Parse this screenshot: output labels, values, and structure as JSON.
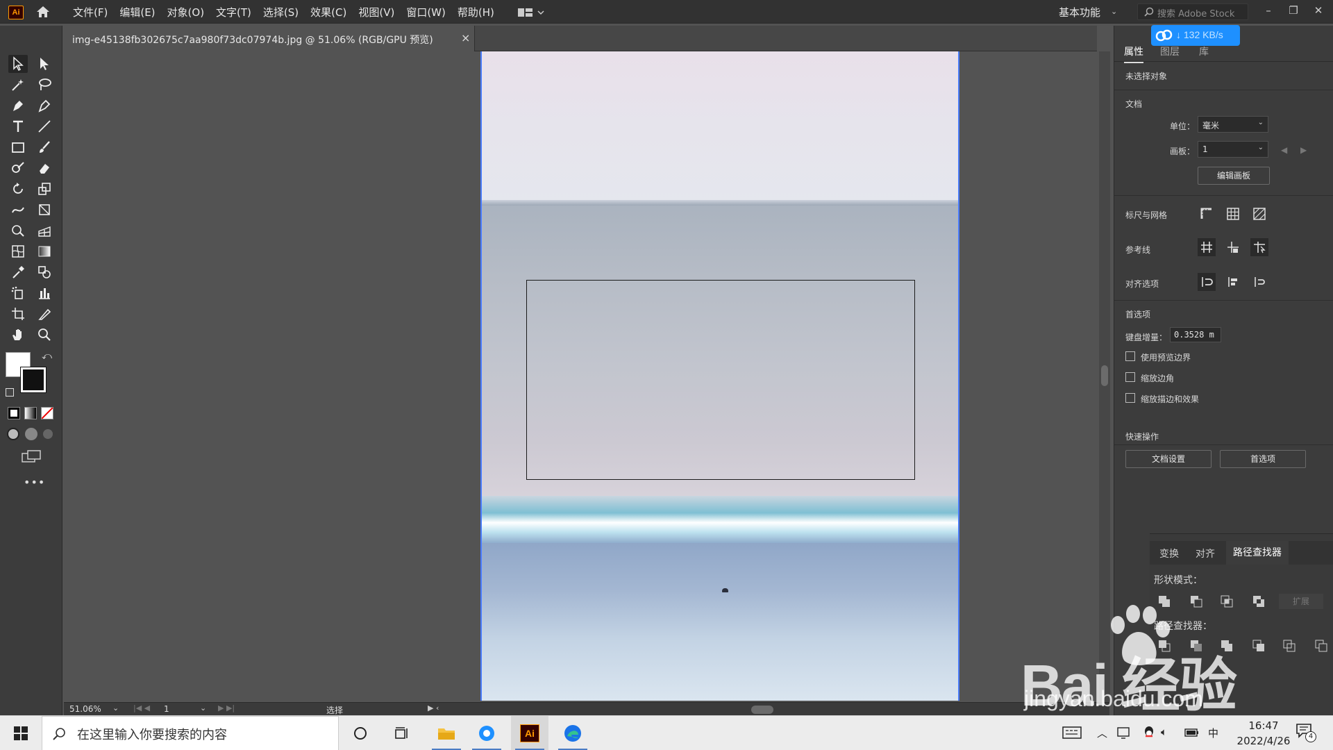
{
  "app": {
    "logo_text": "Ai"
  },
  "menu": [
    "文件(F)",
    "编辑(E)",
    "对象(O)",
    "文字(T)",
    "选择(S)",
    "效果(C)",
    "视图(V)",
    "窗口(W)",
    "帮助(H)"
  ],
  "workspace": {
    "label": "基本功能"
  },
  "stock_search": {
    "placeholder": "搜索 Adobe Stock"
  },
  "download_speed": "↓ 132 KB/s",
  "document": {
    "tab_title": "img-e45138fb302675c7aa980f73dc07974b.jpg @ 51.06% (RGB/GPU 预览)",
    "close": "×"
  },
  "status": {
    "zoom": "51.06%",
    "page": "1",
    "mode": "选择"
  },
  "properties": {
    "tabs": [
      "属性",
      "图层",
      "库"
    ],
    "no_selection": "未选择对象",
    "doc_section": "文档",
    "unit_label": "单位：",
    "unit_value": "毫米",
    "artboard_label": "画板：",
    "artboard_value": "1",
    "edit_artboard": "编辑画板",
    "rulers_grid": "标尺与网格",
    "guides": "参考线",
    "align_options": "对齐选项",
    "preferences": "首选项",
    "key_increment_label": "键盘增量：",
    "key_increment_value": "0.3528 m",
    "checks": [
      "使用预览边界",
      "缩放边角",
      "缩放描边和效果"
    ],
    "quick_actions": "快速操作",
    "doc_settings": "文档设置",
    "prefs_btn": "首选项"
  },
  "pathfinder": {
    "tabs": [
      "变换",
      "对齐",
      "路径查找器"
    ],
    "shape_modes": "形状模式：",
    "expand": "扩展",
    "pathfinders": "路径查找器："
  },
  "watermark": {
    "brand": "Bai 经验",
    "url": "jingyan.baidu.com"
  },
  "taskbar": {
    "search_placeholder": "在这里输入你要搜索的内容",
    "ime": "中",
    "time": "16:47",
    "date": "2022/4/26",
    "notifications": "4"
  },
  "colors": {
    "accent": "#4a7cff",
    "panel": "#3c3c3c",
    "speed_badge": "#1e90ff"
  }
}
